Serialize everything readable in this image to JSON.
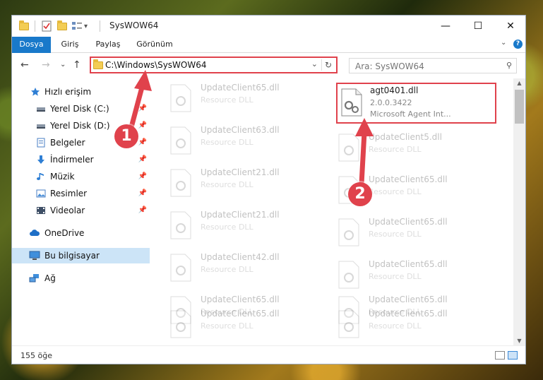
{
  "window": {
    "title": "SysWOW64",
    "minimize_glyph": "—",
    "maximize_glyph": "☐",
    "close_glyph": "✕"
  },
  "ribbon": {
    "tabs": [
      "Dosya",
      "Giriş",
      "Paylaş",
      "Görünüm"
    ],
    "expand_glyph": "⌄",
    "help_glyph": "?"
  },
  "nav": {
    "back_glyph": "←",
    "forward_glyph": "→",
    "recent_glyph": "⌄",
    "up_glyph": "↑"
  },
  "address": {
    "path": "C:\\Windows\\SysWOW64",
    "dropdown_glyph": "⌄",
    "refresh_glyph": "↻"
  },
  "search": {
    "placeholder": "Ara: SysWOW64",
    "icon": "search-icon"
  },
  "sidebar": {
    "items": [
      {
        "label": "Hızlı erişim",
        "icon": "star-icon"
      },
      {
        "label": "Yerel Disk (C:)",
        "icon": "drive-icon",
        "pinned": true
      },
      {
        "label": "Yerel Disk (D:)",
        "icon": "drive-icon",
        "pinned": true
      },
      {
        "label": "Belgeler",
        "icon": "document-icon",
        "pinned": true
      },
      {
        "label": "İndirmeler",
        "icon": "download-icon",
        "pinned": true
      },
      {
        "label": "Müzik",
        "icon": "music-icon",
        "pinned": true
      },
      {
        "label": "Resimler",
        "icon": "pictures-icon",
        "pinned": true
      },
      {
        "label": "Videolar",
        "icon": "video-icon",
        "pinned": true
      },
      {
        "label": "OneDrive",
        "icon": "cloud-icon"
      },
      {
        "label": "Bu bilgisayar",
        "icon": "computer-icon",
        "selected": true
      },
      {
        "label": "Ağ",
        "icon": "network-icon"
      }
    ],
    "pin_glyph": "📌"
  },
  "files": {
    "left_column": [
      {
        "name": "UpdateClient65.dll",
        "desc": "Resource DLL"
      },
      {
        "name": "UpdateClient63.dll",
        "desc": "Resource DLL"
      },
      {
        "name": "UpdateClient21.dll",
        "desc": "Resource DLL"
      },
      {
        "name": "UpdateClient21.dll",
        "desc": "Resource DLL"
      },
      {
        "name": "UpdateClient42.dll",
        "desc": "Resource DLL"
      },
      {
        "name": "UpdateClient65.dll",
        "desc": "Resource DLL"
      },
      {
        "name": "UpdateClient65.dll",
        "desc": "Resource DLL"
      }
    ],
    "highlighted": {
      "name": "agt0401.dll",
      "version": "2.0.0.3422",
      "desc": "Microsoft Agent Int..."
    },
    "right_column": [
      {
        "name": "UpdateClient5.dll",
        "desc": "Resource DLL"
      },
      {
        "name": "UpdateClient65.dll",
        "desc": "Resource DLL"
      },
      {
        "name": "UpdateClient65.dll",
        "desc": "Resource DLL"
      },
      {
        "name": "UpdateClient65.dll",
        "desc": "Resource DLL"
      },
      {
        "name": "UpdateClient65.dll",
        "desc": "Resource DLL"
      },
      {
        "name": "UpdateClient65.dll",
        "desc": "Resource DLL"
      }
    ]
  },
  "status": {
    "item_count": "155 öğe"
  },
  "callouts": [
    {
      "number": "1"
    },
    {
      "number": "2"
    }
  ],
  "colors": {
    "accent": "#1979ca",
    "highlight": "#e0424c",
    "selected": "#cce4f7"
  }
}
